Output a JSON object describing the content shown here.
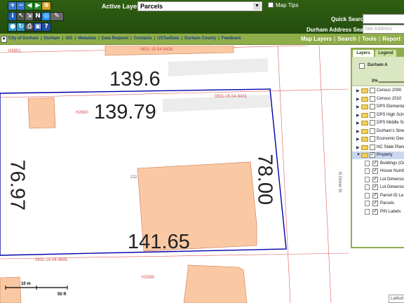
{
  "toolbar": {
    "tool_icons": [
      "zoom-in-icon",
      "zoom-out-icon",
      "previous-extent-icon",
      "next-extent-icon",
      "full-extent-icon",
      "identify-icon",
      "select-icon",
      "measure-icon",
      "north-arrow-icon",
      "buffer-icon",
      "draw-icon",
      "globe-icon",
      "refresh-icon",
      "print-icon",
      "save-icon",
      "help-icon"
    ],
    "active_layer_label": "Active Layer:",
    "active_layer_value": "Parcels",
    "map_tips_label": "Map Tips",
    "quick_search_label": "Quick Search:",
    "quick_search_value": "",
    "address_search_label": "Durham Address Search:",
    "address_placeholder": "Site Address"
  },
  "links": {
    "items": [
      "City of Durham",
      "Durham",
      "GIS",
      "Metadata",
      "Data Request",
      "Contacts",
      "USTaxData",
      "Durham County",
      "Feedback"
    ],
    "right_items": [
      "Map Layers",
      "Search",
      "Tools",
      "Report"
    ]
  },
  "map": {
    "dimensions": [
      "139.6",
      "139.79",
      "76.97",
      "78.00",
      "141.65"
    ],
    "parcel_pins": [
      "0831-15-54-9428",
      "0831-15-54-9431",
      "0831-15-04-9845"
    ],
    "address_labels": [
      "H2601",
      "H2600",
      "211",
      "H2599"
    ],
    "street_name": "N Driver St",
    "scale_top": "10 m",
    "scale_bottom": "50 ft",
    "latitude_label": "Latitud",
    "colors": {
      "building": "#fbc8a4",
      "parcel_line": "#e05a5a",
      "selection": "#0000a8",
      "sidewalk": "#ececec"
    }
  },
  "panel": {
    "tabs": [
      "Layers",
      "Legend"
    ],
    "basemap_label": "Durham A",
    "opacity": "0%",
    "layers": [
      {
        "label": "Census 2000",
        "checked": false
      },
      {
        "label": "Census 2010",
        "checked": false
      },
      {
        "label": "DPS Elementary",
        "checked": false
      },
      {
        "label": "DPS High School",
        "checked": false
      },
      {
        "label": "DPS Middle Sch",
        "checked": false
      },
      {
        "label": "Durham's Stree",
        "checked": false
      },
      {
        "label": "Economic Deve",
        "checked": false
      },
      {
        "label": "NC State Plane",
        "checked": false
      },
      {
        "label": "Property",
        "checked": true
      }
    ],
    "sublayers": [
      {
        "label": "Buildings (Or",
        "checked": true
      },
      {
        "label": "House Numb",
        "checked": true
      },
      {
        "label": "Lot Dimensio",
        "checked": true
      },
      {
        "label": "Lot Dimensio",
        "checked": true
      },
      {
        "label": "Parcel ID La",
        "checked": true
      },
      {
        "label": "Parcels",
        "checked": true
      },
      {
        "label": "PIN Labels",
        "checked": true
      }
    ]
  }
}
